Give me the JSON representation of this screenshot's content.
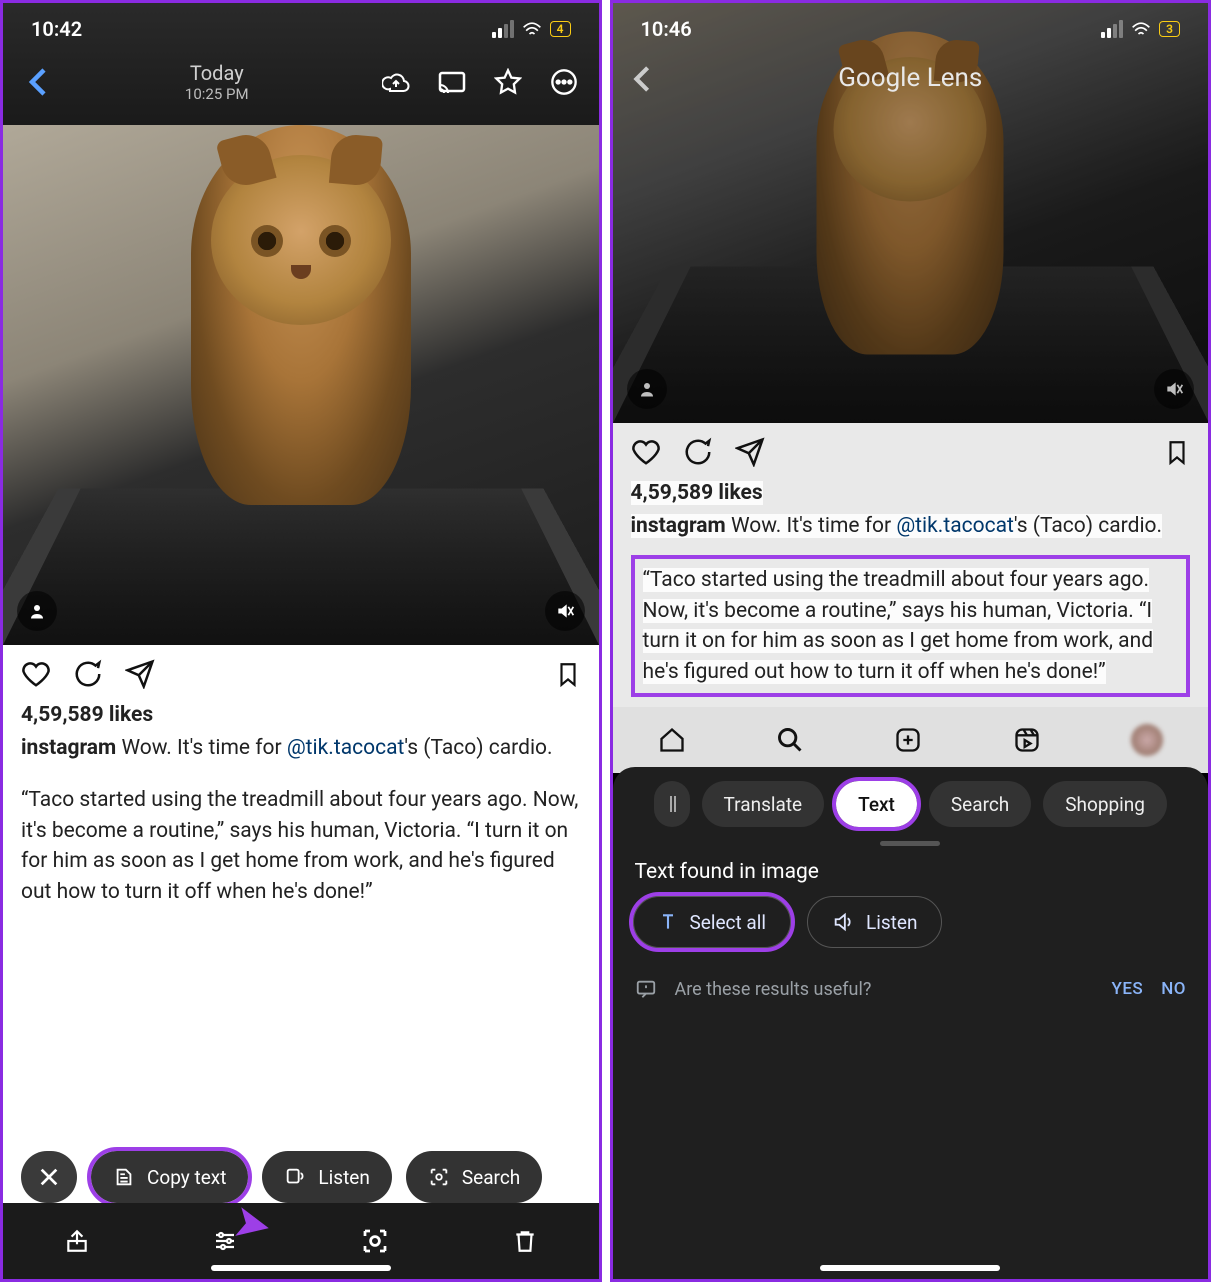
{
  "left": {
    "status": {
      "time": "10:42",
      "battery": "4"
    },
    "topbar": {
      "title": "Today",
      "subtitle": "10:25 PM"
    },
    "ig": {
      "likes": "4,59,589 likes",
      "user": "instagram",
      "caption_pre": " Wow. It's time for ",
      "mention": "@tik.tacocat",
      "caption_post": "'s (Taco) cardio.",
      "quote": "“Taco started using the treadmill about four years ago. Now, it's become a routine,” says his human, Victoria. “I turn it on for him as soon as I get home from work, and he's figured out how to turn it off when he's done!”"
    },
    "chips": {
      "copy": "Copy text",
      "listen": "Listen",
      "search": "Search"
    }
  },
  "right": {
    "status": {
      "time": "10:46",
      "battery": "3"
    },
    "header": {
      "title": "Google Lens"
    },
    "ig": {
      "likes": "4,59,589 likes",
      "user": "instagram",
      "caption_pre": " Wow. It's time for ",
      "mention": "@tik.tacocat",
      "caption_post": "'s (Taco) cardio.",
      "quote": "“Taco started using the treadmill about four years ago. Now, it's become a routine,” says his human, Victoria. “I turn it on for him as soon as I get home from work, and he's figured out how to turn it off when he's done!”"
    },
    "modes": {
      "translate": "Translate",
      "text": "Text",
      "search": "Search",
      "shopping": "Shopping"
    },
    "sheet": {
      "title": "Text found in image",
      "select_all": "Select all",
      "listen": "Listen",
      "feedback_q": "Are these results useful?",
      "yes": "YES",
      "no": "NO"
    }
  }
}
